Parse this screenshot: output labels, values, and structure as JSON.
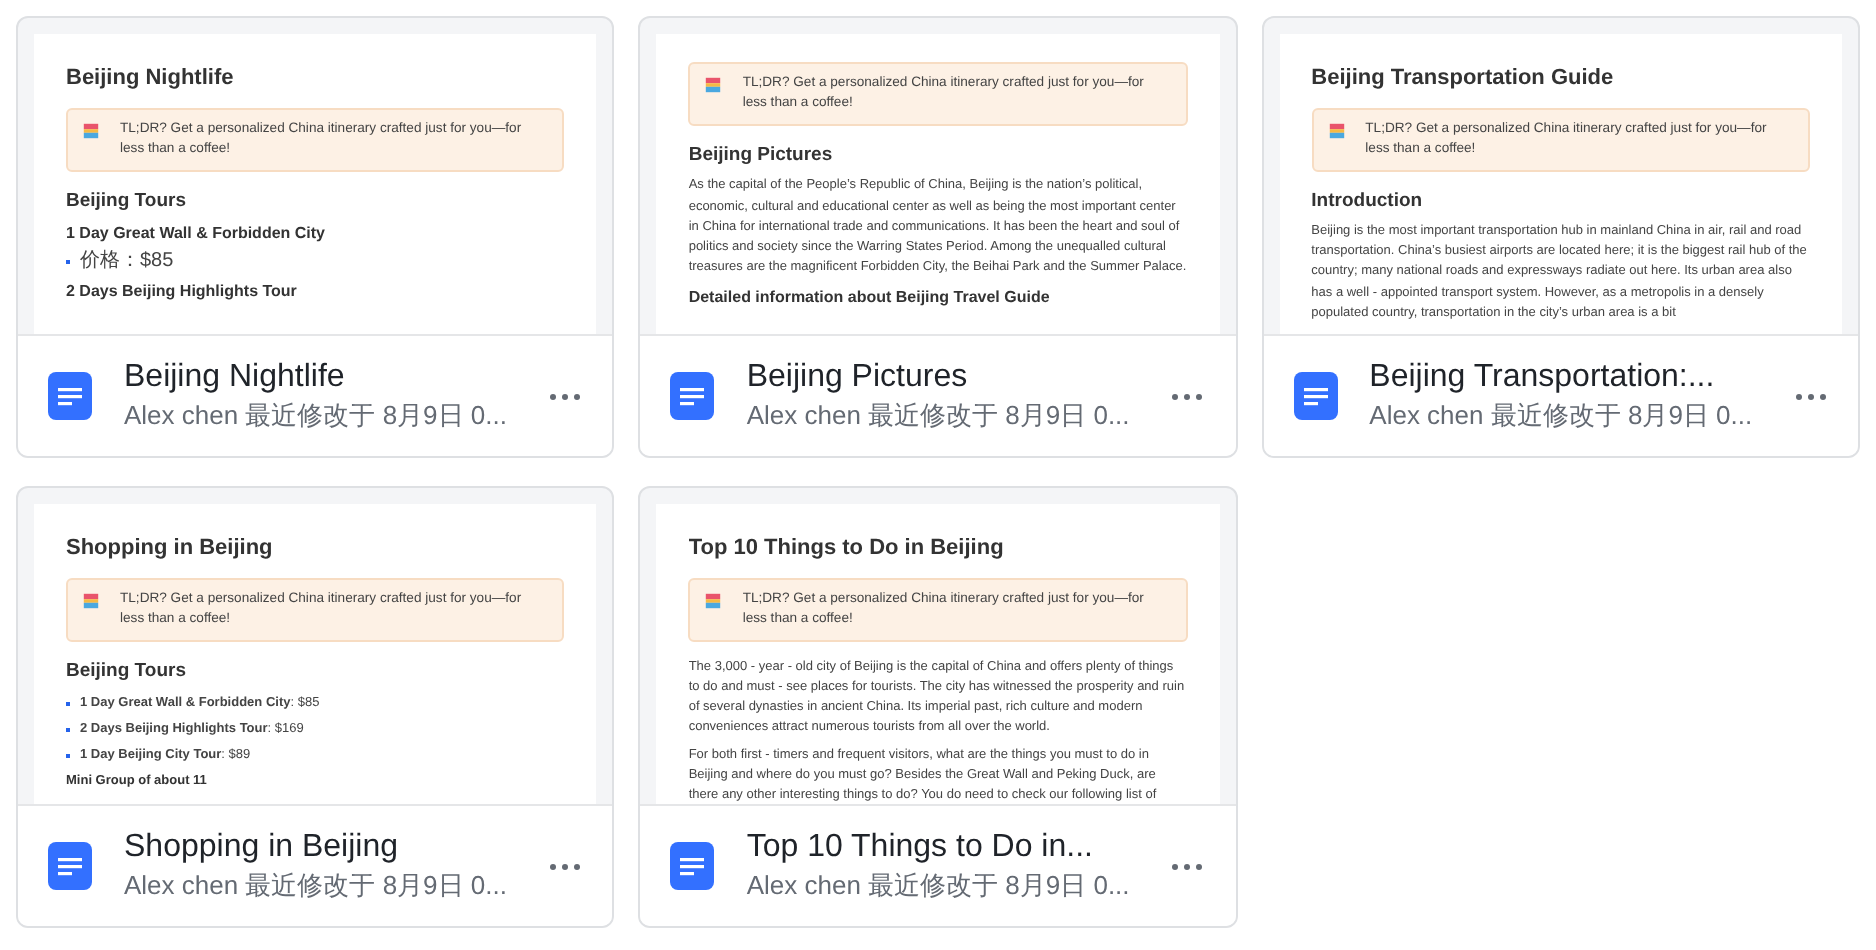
{
  "cards": [
    {
      "title": "Beijing Nightlife",
      "subtitle": "Alex chen 最近修改于 8月9日 0...",
      "preview": [
        {
          "kind": "title",
          "text": "Beijing Nightlife"
        },
        {
          "kind": "banner",
          "text": "TL;DR? Get a personalized China itinerary crafted just for you—for less than a coffee!"
        },
        {
          "kind": "heading",
          "text": "Beijing Tours"
        },
        {
          "kind": "subheading",
          "text": "1 Day Great Wall & Forbidden City"
        },
        {
          "kind": "bullet",
          "text": "价格：$85"
        },
        {
          "kind": "subheading",
          "text": "2 Days Beijing Highlights Tour"
        }
      ]
    },
    {
      "title": "Beijing Pictures",
      "subtitle": "Alex chen 最近修改于 8月9日 0...",
      "preview": [
        {
          "kind": "banner",
          "text": "TL;DR? Get a personalized China itinerary crafted just for you—for less than a coffee!"
        },
        {
          "kind": "heading",
          "text": "Beijing Pictures"
        },
        {
          "kind": "paragraph",
          "text": "As the capital of the People’s Republic of China, Beijing is the nation’s political, economic, cultural and educational center as well as being the most important center in China for international trade and communications. It has been the heart and soul of politics and society since the Warring States Period. Among the unequalled cultural treasures are the magnificent Forbidden City, the Beihai Park and the Summer Palace."
        },
        {
          "kind": "subheading",
          "text": "Detailed information about Beijing Travel Guide"
        }
      ]
    },
    {
      "title": "Beijing Transportation:...",
      "subtitle": "Alex chen 最近修改于 8月9日 0...",
      "preview": [
        {
          "kind": "title",
          "text": "Beijing Transportation Guide"
        },
        {
          "kind": "banner",
          "text": "TL;DR? Get a personalized China itinerary crafted just for you—for less than a coffee!"
        },
        {
          "kind": "heading",
          "text": "Introduction"
        },
        {
          "kind": "paragraph",
          "text": "Beijing is the most important transportation hub in mainland China in air, rail and road transportation. China’s busiest airports are located here; it is the biggest rail hub of the country; many national roads and expressways radiate out here. Its urban area also has a well - appointed transport system. However, as a metropolis in a densely populated country, transportation in the city’s urban area is a bit"
        }
      ]
    },
    {
      "title": "Shopping in Beijing",
      "subtitle": "Alex chen 最近修改于 8月9日 0...",
      "preview": [
        {
          "kind": "title",
          "text": "Shopping in Beijing"
        },
        {
          "kind": "banner",
          "text": "TL;DR? Get a personalized China itinerary crafted just for you—for less than a coffee!"
        },
        {
          "kind": "heading",
          "text": "Beijing Tours"
        },
        {
          "kind": "bullet",
          "text": "**1 Day Great Wall & Forbidden City**: $85"
        },
        {
          "kind": "bullet",
          "text": "**2 Days Beijing Highlights Tour**: $169"
        },
        {
          "kind": "bullet",
          "text": "**1 Day Beijing City Tour**: $89"
        },
        {
          "kind": "label",
          "text": "Mini Group of about 11"
        }
      ]
    },
    {
      "title": "Top 10 Things to Do in...",
      "subtitle": "Alex chen 最近修改于 8月9日 0...",
      "preview": [
        {
          "kind": "title",
          "text": "Top 10 Things to Do in Beijing"
        },
        {
          "kind": "banner",
          "text": "TL;DR? Get a personalized China itinerary crafted just for you—for less than a coffee!"
        },
        {
          "kind": "paragraph",
          "text": "The 3,000 - year - old city of Beijing is the capital of China and offers plenty of things to do and must - see places for tourists. The city has witnessed the prosperity and ruin of several dynasties in ancient China. Its imperial past, rich culture and modern conveniences attract numerous tourists from all over the world."
        },
        {
          "kind": "paragraph",
          "text": "For both first - timers and frequent visitors, what are the things you must to do in Beijing and where do you must go? Besides the Great Wall and Peking Duck, are there any other interesting things to do? You do need to check our following list of"
        }
      ]
    }
  ]
}
